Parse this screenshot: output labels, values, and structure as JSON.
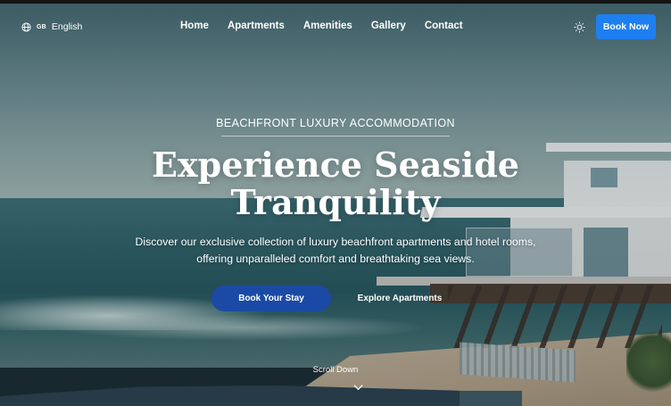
{
  "nav": {
    "language_code": "GB",
    "language_label": "English",
    "links": [
      {
        "label": "Home"
      },
      {
        "label": "Apartments"
      },
      {
        "label": "Amenities"
      },
      {
        "label": "Gallery"
      },
      {
        "label": "Contact"
      }
    ],
    "theme_icon": "sun-icon",
    "book_now_label": "Book Now"
  },
  "hero": {
    "eyebrow": "BEACHFRONT LUXURY ACCOMMODATION",
    "title_line1": "Experience Seaside",
    "title_line2": "Tranquility",
    "description": "Discover our exclusive collection of luxury beachfront apartments and hotel rooms, offering unparalleled comfort and breathtaking sea views.",
    "primary_button": "Book Your Stay",
    "secondary_button": "Explore Apartments",
    "scroll_label": "Scroll Down"
  },
  "colors": {
    "accent": "#1e7ff0",
    "primary_button": "#1a4aa5"
  }
}
